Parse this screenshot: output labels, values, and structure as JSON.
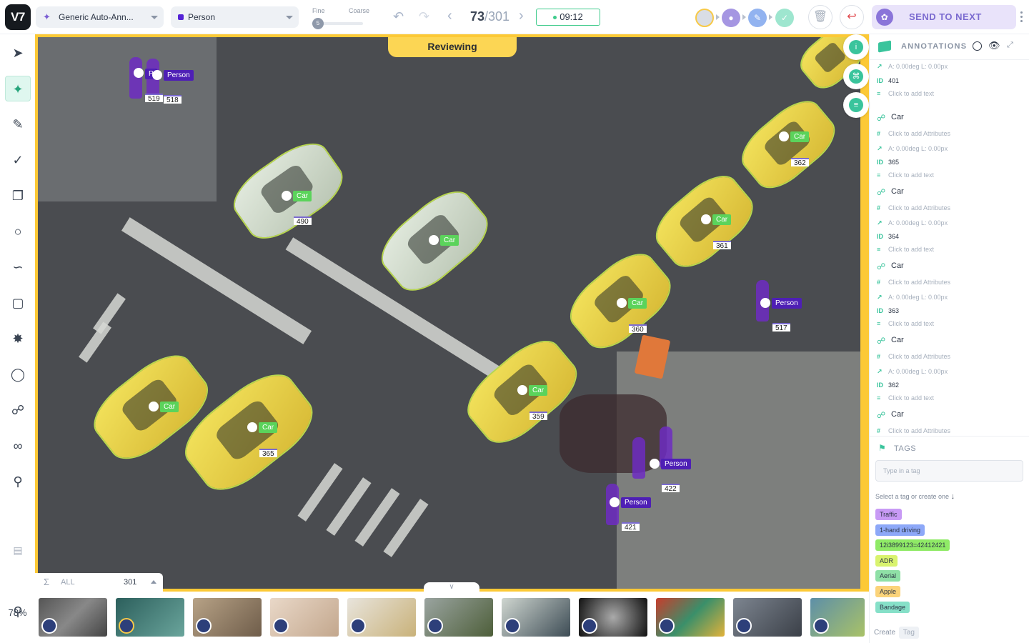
{
  "topbar": {
    "logo": "V7",
    "model_dropdown": "Generic Auto-Ann...",
    "class_dropdown": "Person",
    "class_color": "#5423d6",
    "slider_fine_label": "Fine",
    "slider_coarse_label": "Coarse",
    "slider_value": "5",
    "frame_current": "73",
    "frame_total": "/301",
    "timer": "09:12",
    "send_label": "SEND TO NEXT STAGE"
  },
  "canvas": {
    "status_banner": "Reviewing",
    "annotations": [
      {
        "cls": "Car",
        "id": "490"
      },
      {
        "cls": "Car",
        "id": ""
      },
      {
        "cls": "Car",
        "id": "362"
      },
      {
        "cls": "Car",
        "id": "361"
      },
      {
        "cls": "Car",
        "id": "360"
      },
      {
        "cls": "Car",
        "id": "359"
      },
      {
        "cls": "Car",
        "id": ""
      },
      {
        "cls": "Car",
        "id": "365"
      },
      {
        "cls": "Person",
        "id": "518"
      },
      {
        "cls": "Person",
        "id": "517"
      },
      {
        "cls": "Person",
        "id": "422"
      },
      {
        "cls": "Person",
        "id": "421"
      }
    ],
    "person_id_top_left": "519",
    "partial_label": "P"
  },
  "filmstrip": {
    "all_label": "ALL",
    "count": "301",
    "sum_icon": "Σ"
  },
  "zoom_level": "78%",
  "panel": {
    "title": "ANNOTATIONS",
    "first_partial": {
      "angle": "A: 0.00deg L: 0.00px",
      "id": "401",
      "text": "Click to add text"
    },
    "items": [
      {
        "name": "Car",
        "attrs": "Click to add Attributes",
        "angle": "A: 0.00deg L: 0.00px",
        "id": "365",
        "text": "Click to add text"
      },
      {
        "name": "Car",
        "attrs": "Click to add Attributes",
        "angle": "A: 0.00deg L: 0.00px",
        "id": "364",
        "text": "Click to add text"
      },
      {
        "name": "Car",
        "attrs": "Click to add Attributes",
        "angle": "A: 0.00deg L: 0.00px",
        "id": "363",
        "text": "Click to add text"
      },
      {
        "name": "Car",
        "attrs": "Click to add Attributes",
        "angle": "A: 0.00deg L: 0.00px",
        "id": "362",
        "text": "Click to add text"
      },
      {
        "name": "Car",
        "attrs": "Click to add Attributes"
      }
    ],
    "tags_title": "TAGS",
    "tag_placeholder": "Type in a tag",
    "tag_hint": "Select a tag or create one",
    "tags": [
      {
        "label": "Traffic",
        "color": "#c89af5"
      },
      {
        "label": "1-hand driving",
        "color": "#8da8f8"
      },
      {
        "label": "12i3899123=42412421",
        "color": "#8fea66"
      },
      {
        "label": "ADR",
        "color": "#d9f36e"
      },
      {
        "label": "Aerial",
        "color": "#8fe0a6"
      },
      {
        "label": "Apple",
        "color": "#fbd37a"
      },
      {
        "label": "Bandage",
        "color": "#86e0c8"
      }
    ],
    "create_label": "Create",
    "create_tag_btn": "Tag"
  }
}
